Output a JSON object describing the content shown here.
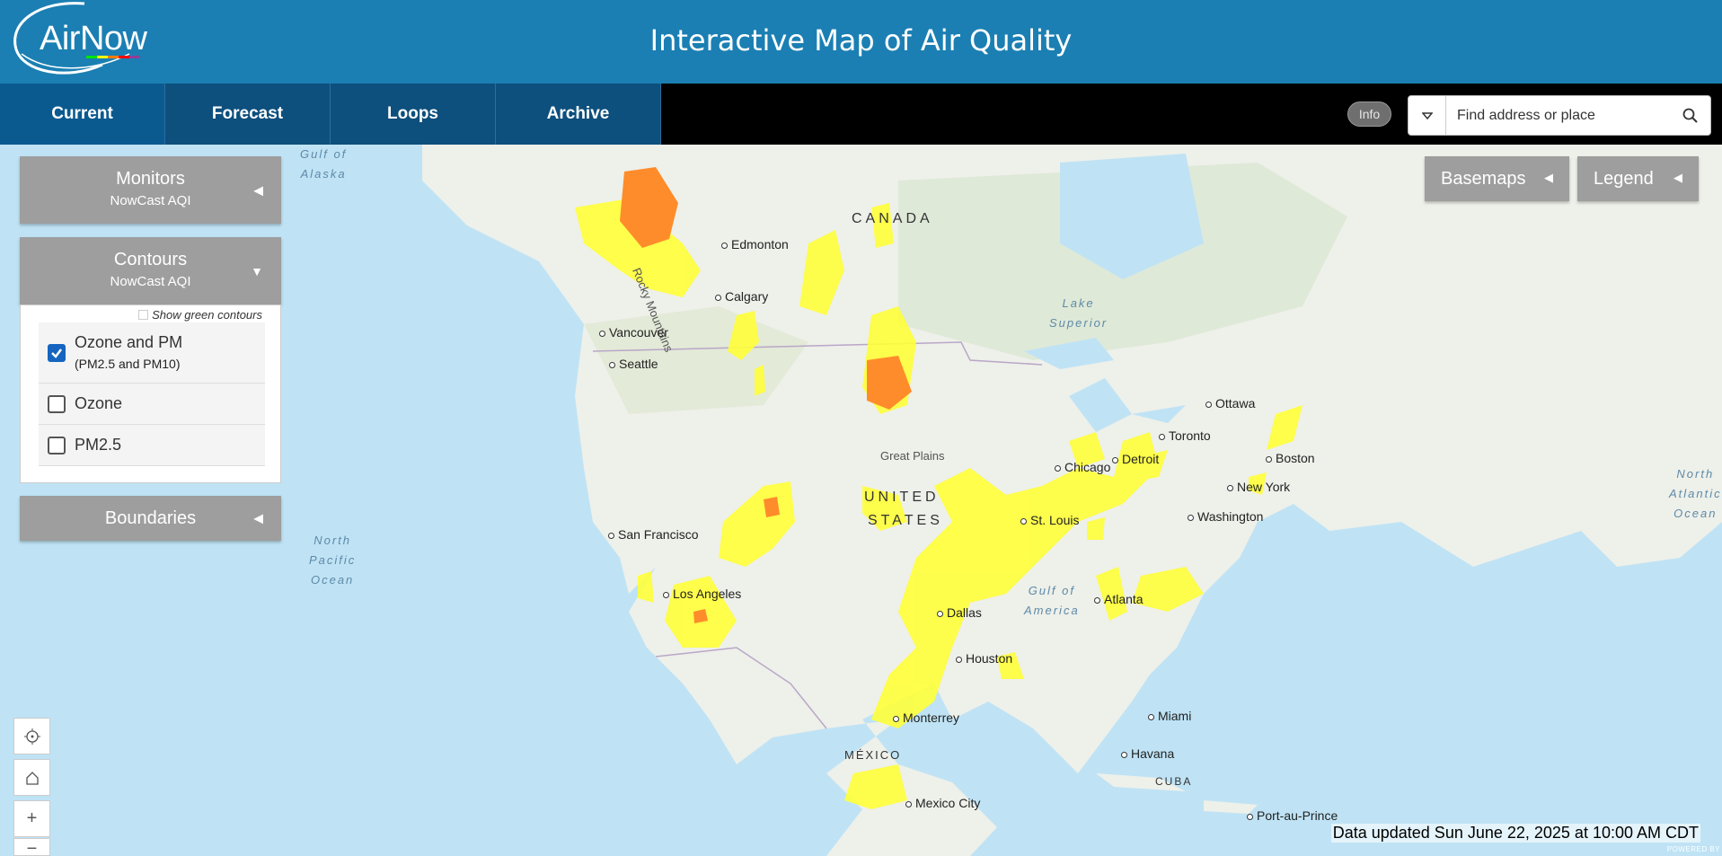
{
  "header": {
    "logo_text": "AirNow",
    "title": "Interactive Map of Air Quality"
  },
  "tabs": [
    {
      "label": "Current",
      "active": true
    },
    {
      "label": "Forecast",
      "active": false
    },
    {
      "label": "Loops",
      "active": false
    },
    {
      "label": "Archive",
      "active": false
    }
  ],
  "toolbar": {
    "info_label": "Info",
    "search_placeholder": "Find address or place"
  },
  "panels": {
    "monitors": {
      "title": "Monitors",
      "subtitle": "NowCast AQI"
    },
    "contours": {
      "title": "Contours",
      "subtitle": "NowCast AQI",
      "show_green_label": "Show green contours",
      "show_green_checked": false,
      "options": [
        {
          "label": "Ozone and PM",
          "sub": "(PM2.5 and PM10)",
          "checked": true
        },
        {
          "label": "Ozone",
          "sub": "",
          "checked": false
        },
        {
          "label": "PM2.5",
          "sub": "",
          "checked": false
        }
      ]
    },
    "boundaries": {
      "title": "Boundaries"
    }
  },
  "right_buttons": {
    "basemaps": "Basemaps",
    "legend": "Legend"
  },
  "map": {
    "cities": [
      "Edmonton",
      "Calgary",
      "Vancouver",
      "Seattle",
      "San Francisco",
      "Los Angeles",
      "Dallas",
      "Houston",
      "Monterrey",
      "Mexico City",
      "St. Louis",
      "Chicago",
      "Detroit",
      "Toronto",
      "Ottawa",
      "Boston",
      "New York",
      "Washington",
      "Atlanta",
      "Miami",
      "Havana",
      "Port-au-Prince"
    ],
    "countries": [
      "CANADA",
      "UNITED",
      "STATES",
      "MÉXICO",
      "CUBA"
    ],
    "waters": [
      "Gulf of",
      "Alaska",
      "North",
      "Pacific",
      "Ocean",
      "Lake",
      "Superior",
      "Gulf of",
      "America",
      "North",
      "Atlantic",
      "Ocean"
    ],
    "regions": [
      "Great Plains",
      "Rocky Mountains"
    ],
    "colors": {
      "good_water": "#bfe3f5",
      "moderate": "#ffff3a",
      "usg": "#ff8c2a"
    }
  },
  "status": {
    "updated": "Data updated Sun June 22, 2025 at 10:00 AM CDT",
    "powered": "POWERED BY"
  }
}
